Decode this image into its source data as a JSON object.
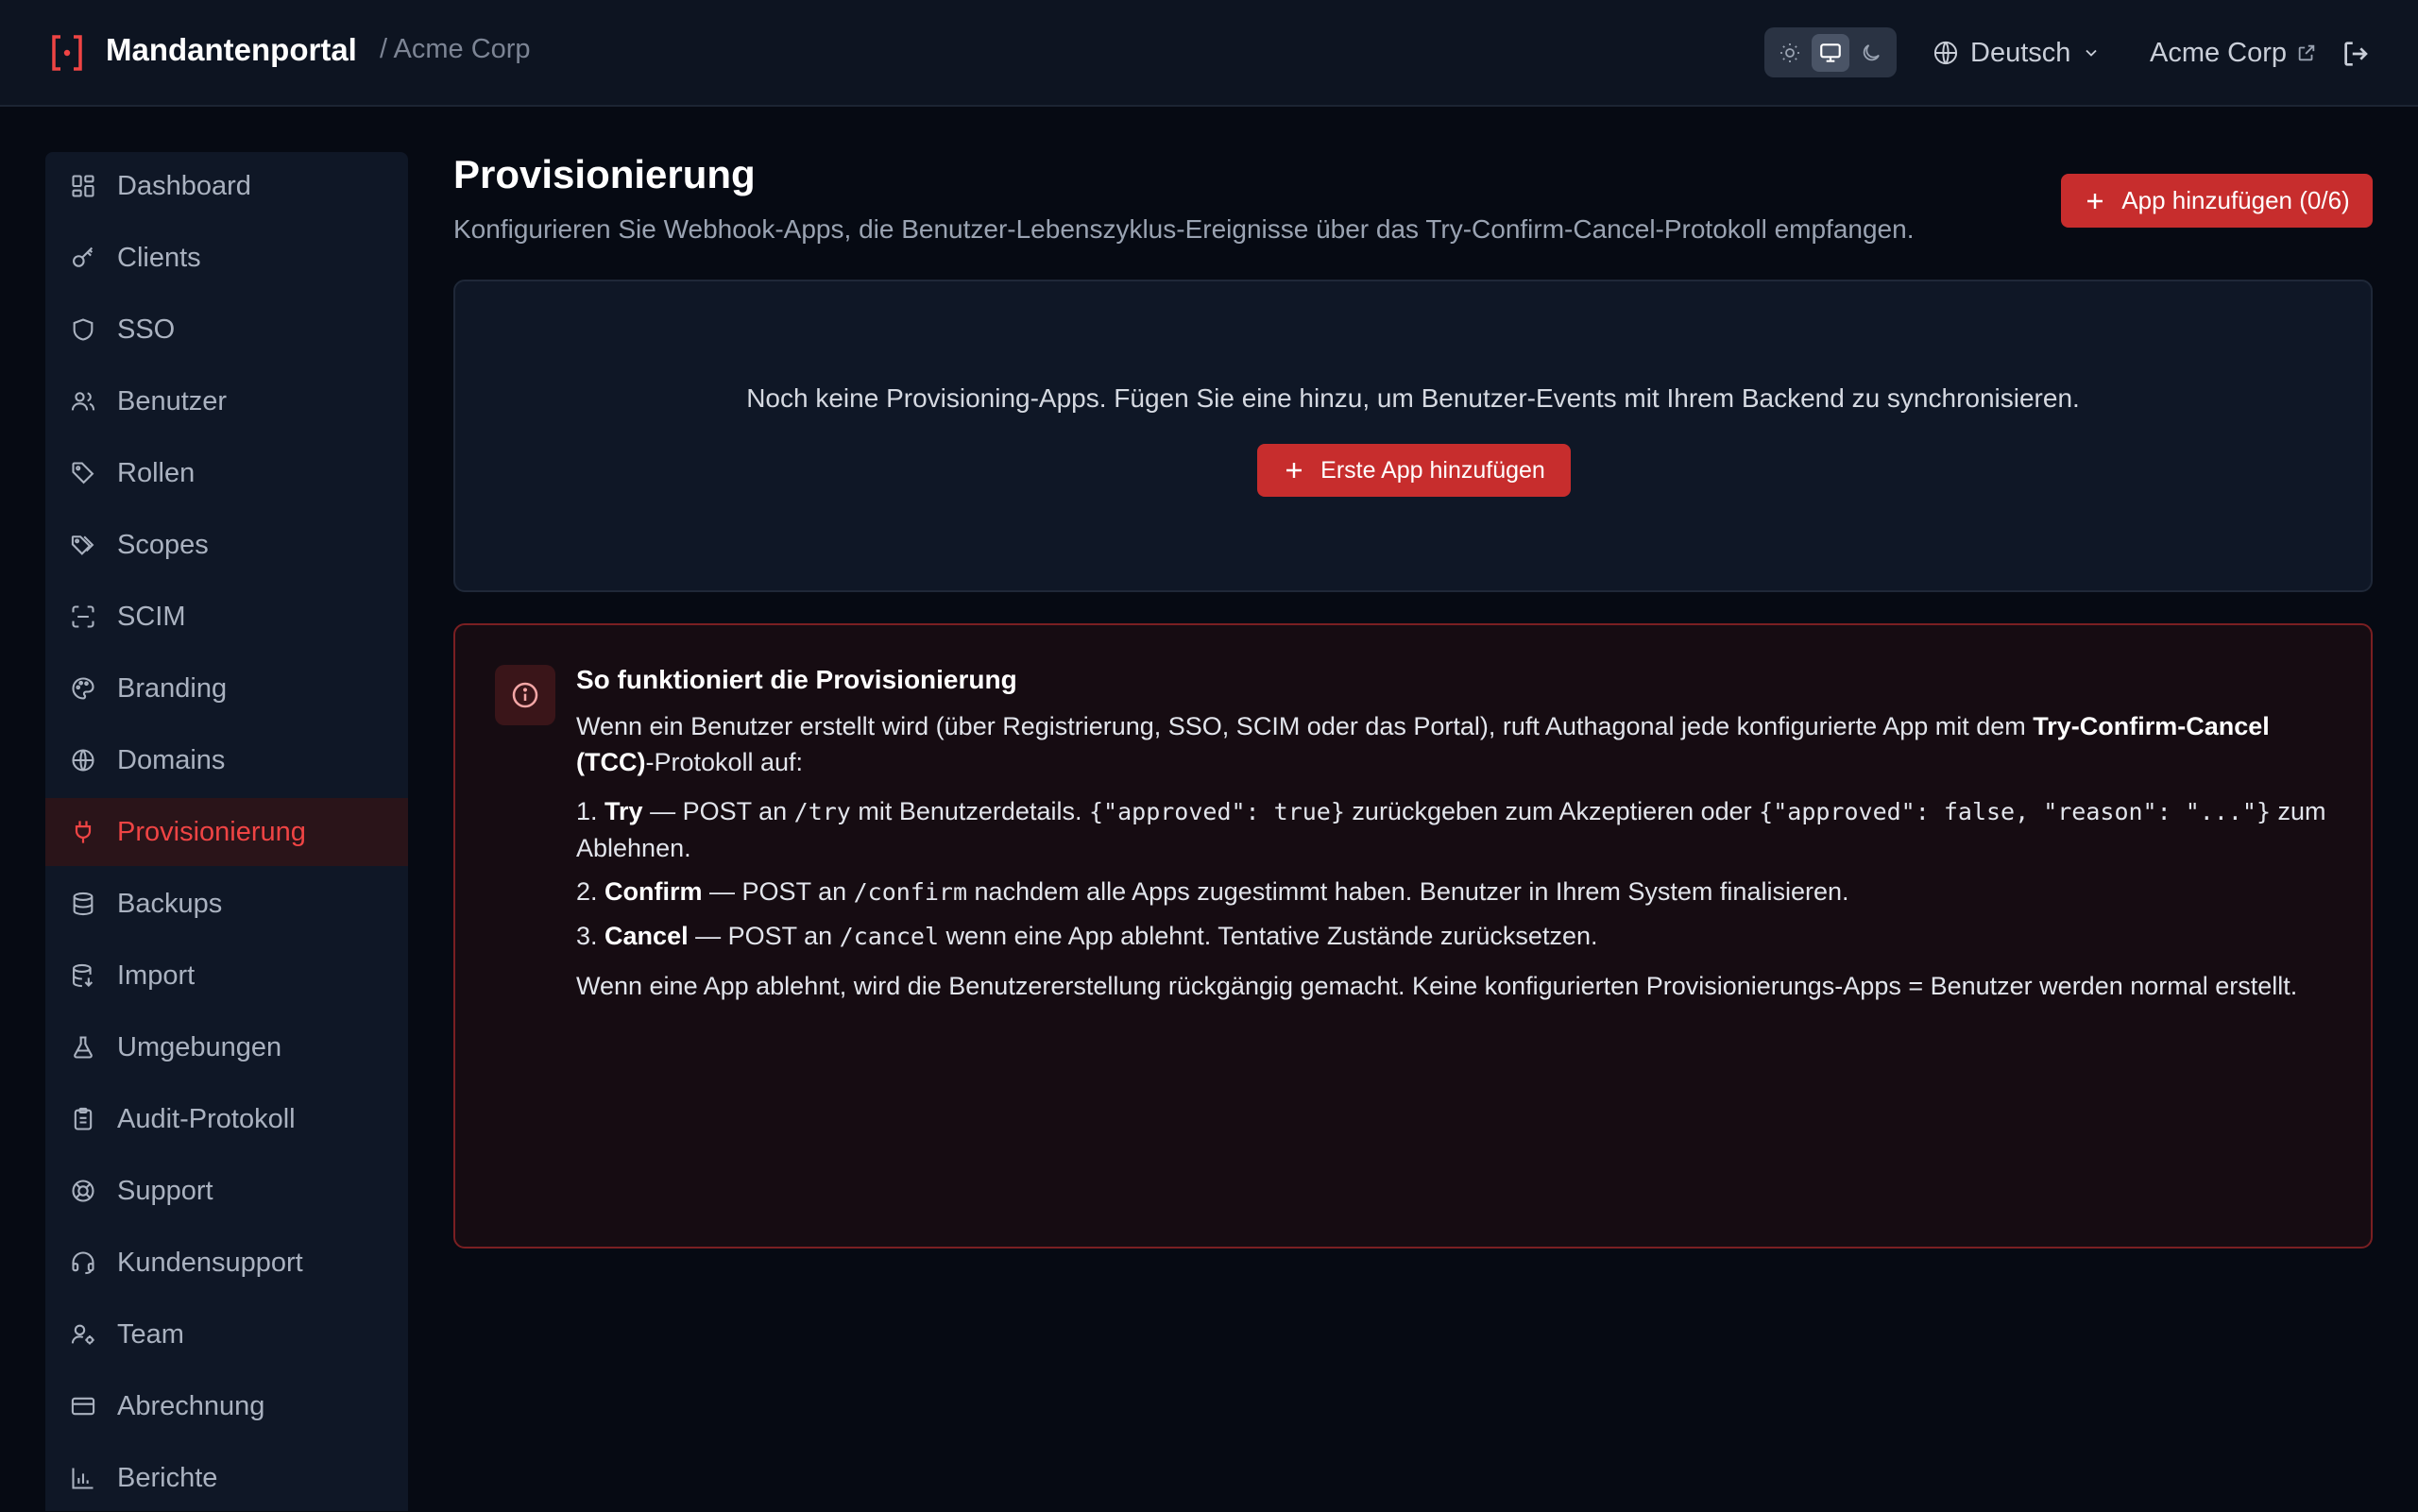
{
  "header": {
    "app_name": "Mandantenportal",
    "tenant_crumb": "/ Acme Corp",
    "language": "Deutsch",
    "tenant_link": "Acme Corp"
  },
  "sidebar": {
    "items": [
      {
        "label": "Dashboard",
        "icon": "dashboard-icon"
      },
      {
        "label": "Clients",
        "icon": "key-icon"
      },
      {
        "label": "SSO",
        "icon": "shield-icon"
      },
      {
        "label": "Benutzer",
        "icon": "users-icon"
      },
      {
        "label": "Rollen",
        "icon": "tag-icon"
      },
      {
        "label": "Scopes",
        "icon": "tags-icon"
      },
      {
        "label": "SCIM",
        "icon": "scan-icon"
      },
      {
        "label": "Branding",
        "icon": "palette-icon"
      },
      {
        "label": "Domains",
        "icon": "globe-icon"
      },
      {
        "label": "Provisionierung",
        "icon": "plug-icon",
        "active": true
      },
      {
        "label": "Backups",
        "icon": "database-icon"
      },
      {
        "label": "Import",
        "icon": "database-import-icon"
      },
      {
        "label": "Umgebungen",
        "icon": "flask-icon"
      },
      {
        "label": "Audit-Protokoll",
        "icon": "clipboard-icon"
      },
      {
        "label": "Support",
        "icon": "lifebuoy-icon"
      },
      {
        "label": "Kundensupport",
        "icon": "headset-icon"
      },
      {
        "label": "Team",
        "icon": "user-cog-icon"
      },
      {
        "label": "Abrechnung",
        "icon": "credit-card-icon"
      },
      {
        "label": "Berichte",
        "icon": "bar-chart-icon"
      }
    ]
  },
  "main": {
    "title": "Provisionierung",
    "subtitle": "Konfigurieren Sie Webhook-Apps, die Benutzer-Lebenszyklus-Ereignisse über das Try-Confirm-Cancel-Protokoll empfangen.",
    "add_button": "App hinzufügen (0/6)",
    "empty_text": "Noch keine Provisioning-Apps. Fügen Sie eine hinzu, um Benutzer-Events mit Ihrem Backend zu synchronisieren.",
    "first_button": "Erste App hinzufügen"
  },
  "info": {
    "title": "So funktioniert die Provisionierung",
    "intro_a": "Wenn ein Benutzer erstellt wird (über Registrierung, SSO, SCIM oder das Portal), ruft Authagonal jede konfigurierte App mit dem ",
    "intro_bold": "Try-Confirm-Cancel (TCC)",
    "intro_b": "-Protokoll auf:",
    "step1_num": "1.",
    "step1_name": "Try",
    "step1_a": " — POST an ",
    "step1_path": "/try",
    "step1_b": " mit Benutzerdetails. ",
    "step1_code1": "{\"approved\": true}",
    "step1_c": " zurückgeben zum Akzeptieren oder ",
    "step1_code2": "{\"approved\": false, \"reason\": \"...\"}",
    "step1_d": " zum Ablehnen.",
    "step2_num": "2.",
    "step2_name": "Confirm",
    "step2_a": " — POST an ",
    "step2_path": "/confirm",
    "step2_b": " nachdem alle Apps zugestimmt haben. Benutzer in Ihrem System finalisieren.",
    "step3_num": "3.",
    "step3_name": "Cancel",
    "step3_a": " — POST an ",
    "step3_path": "/cancel",
    "step3_b": " wenn eine App ablehnt. Tentative Zustände zurücksetzen.",
    "outro": "Wenn eine App ablehnt, wird die Benutzererstellung rückgängig gemacht. Keine konfigurierten Provisionierungs-Apps = Benutzer werden normal erstellt."
  },
  "colors": {
    "accent": "#c72d2d",
    "accent_text": "#ef4444",
    "background": "#060a13",
    "panel": "#0f1726"
  }
}
